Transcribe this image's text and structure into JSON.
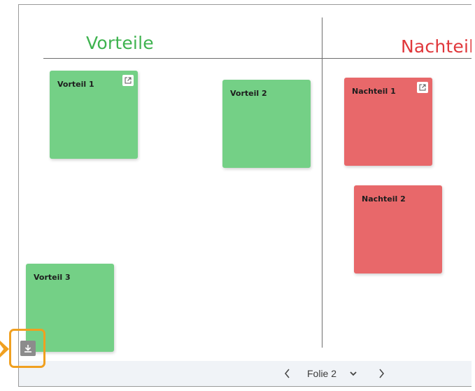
{
  "headings": {
    "vorteile": "Vorteile",
    "nachteile": "Nachteil"
  },
  "notes": {
    "vorteil_1": "Vorteil 1",
    "vorteil_2": "Vorteil 2",
    "vorteil_3": "Vorteil 3",
    "nachteil_1": "Nachteil 1",
    "nachteil_2": "Nachteil 2"
  },
  "footer": {
    "slide_label": "Folie 2"
  },
  "colors": {
    "green_heading": "#3fb34f",
    "red_heading": "#e0373b",
    "green_note": "#74d086",
    "red_note": "#e8686a",
    "highlight": "#f0a020"
  },
  "icons": [
    "external-link-icon",
    "chevron-left-icon",
    "chevron-down-icon",
    "chevron-right-icon",
    "download-icon"
  ]
}
